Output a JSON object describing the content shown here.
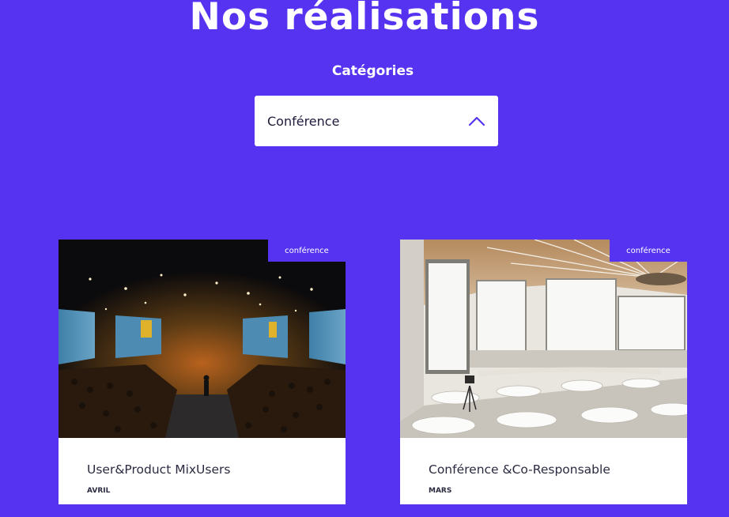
{
  "page": {
    "title": "Nos réalisations"
  },
  "filter": {
    "label": "Catégories",
    "selected": "Conférence"
  },
  "colors": {
    "accent": "#5533f0",
    "card_bg": "#ffffff",
    "text_dark": "#2a2a40"
  },
  "icons": {
    "select_toggle": "chevron-up-icon"
  },
  "cards": [
    {
      "badge": "conférence",
      "title": "User&Product MixUsers",
      "date": "AVRIL"
    },
    {
      "badge": "conférence",
      "title": "Conférence &Co-Responsable",
      "date": "MARS"
    }
  ]
}
